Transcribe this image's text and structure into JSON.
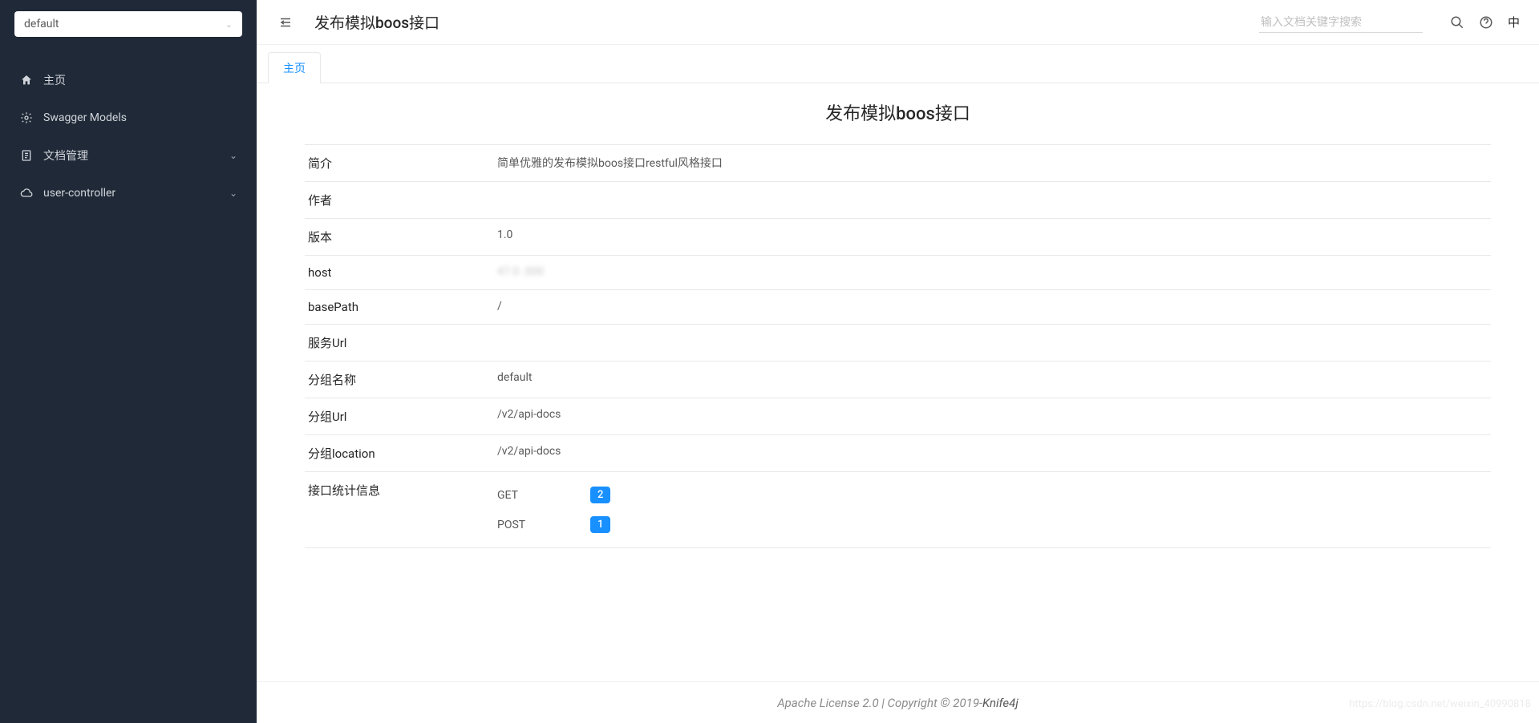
{
  "sidebar": {
    "select_value": "default",
    "items": [
      {
        "label": "主页",
        "icon": "home"
      },
      {
        "label": "Swagger Models",
        "icon": "models"
      },
      {
        "label": "文档管理",
        "icon": "doc",
        "expandable": true
      },
      {
        "label": "user-controller",
        "icon": "cloud",
        "expandable": true
      }
    ]
  },
  "header": {
    "title": "发布模拟boos接口",
    "search_placeholder": "输入文档关键字搜索",
    "lang": "中"
  },
  "tabs": {
    "home_label": "主页"
  },
  "content": {
    "title": "发布模拟boos接口",
    "info": {
      "intro_key": "简介",
      "intro_val": "简单优雅的发布模拟boos接口restful风格接口",
      "author_key": "作者",
      "author_val": "",
      "version_key": "版本",
      "version_val": "1.0",
      "host_key": "host",
      "host_val": "47.0        .000",
      "basepath_key": "basePath",
      "basepath_val": "/",
      "serviceurl_key": "服务Url",
      "serviceurl_val": "",
      "groupname_key": "分组名称",
      "groupname_val": "default",
      "groupurl_key": "分组Url",
      "groupurl_val": "/v2/api-docs",
      "grouploc_key": "分组location",
      "grouploc_val": "/v2/api-docs",
      "stats_key": "接口统计信息",
      "stats": {
        "get_label": "GET",
        "get_count": "2",
        "post_label": "POST",
        "post_count": "1"
      }
    }
  },
  "footer": {
    "license": "Apache License 2.0",
    "copyright_text": " | Copyright ",
    "year": "2019-",
    "product": "Knife4j"
  },
  "watermark": "https://blog.csdn.net/weixin_40990818"
}
